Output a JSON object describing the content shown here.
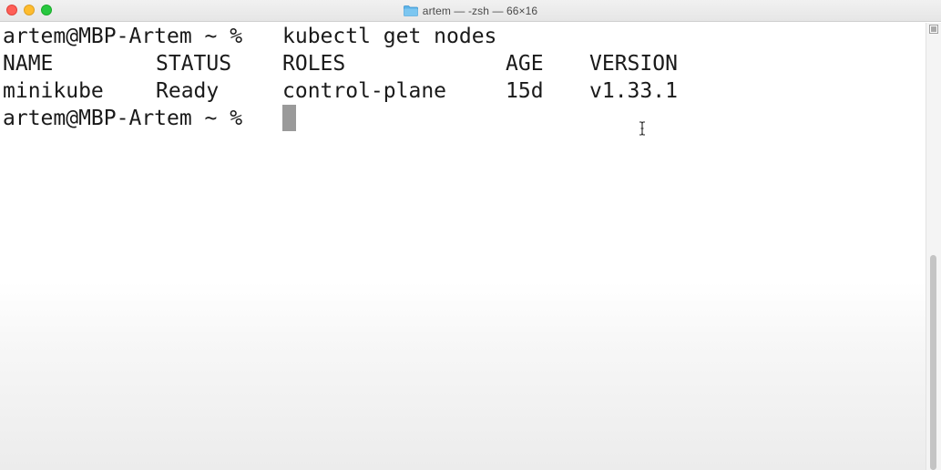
{
  "window": {
    "title": "artem — -zsh — 66×16"
  },
  "terminal": {
    "lines": [
      {
        "prompt": "artem@MBP-Artem ~ %",
        "command": "kubectl get nodes"
      },
      {
        "cols": [
          "NAME",
          "STATUS",
          "ROLES",
          "AGE",
          "VERSION"
        ]
      },
      {
        "cols": [
          "minikube",
          "Ready",
          "control-plane",
          "15d",
          "v1.33.1"
        ]
      },
      {
        "prompt": "artem@MBP-Artem ~ %",
        "command": ""
      }
    ]
  },
  "icons": {
    "folder": "folder-icon",
    "cursor": "text-ibeam-icon",
    "scroll_button": "scroll-menu-icon"
  },
  "colors": {
    "close": "#fe5f57",
    "minimize": "#febc2e",
    "maximize": "#28c840",
    "folder": "#5bb3e8",
    "text": "#1a1a1a",
    "cursor_block": "#9a9a9a"
  }
}
